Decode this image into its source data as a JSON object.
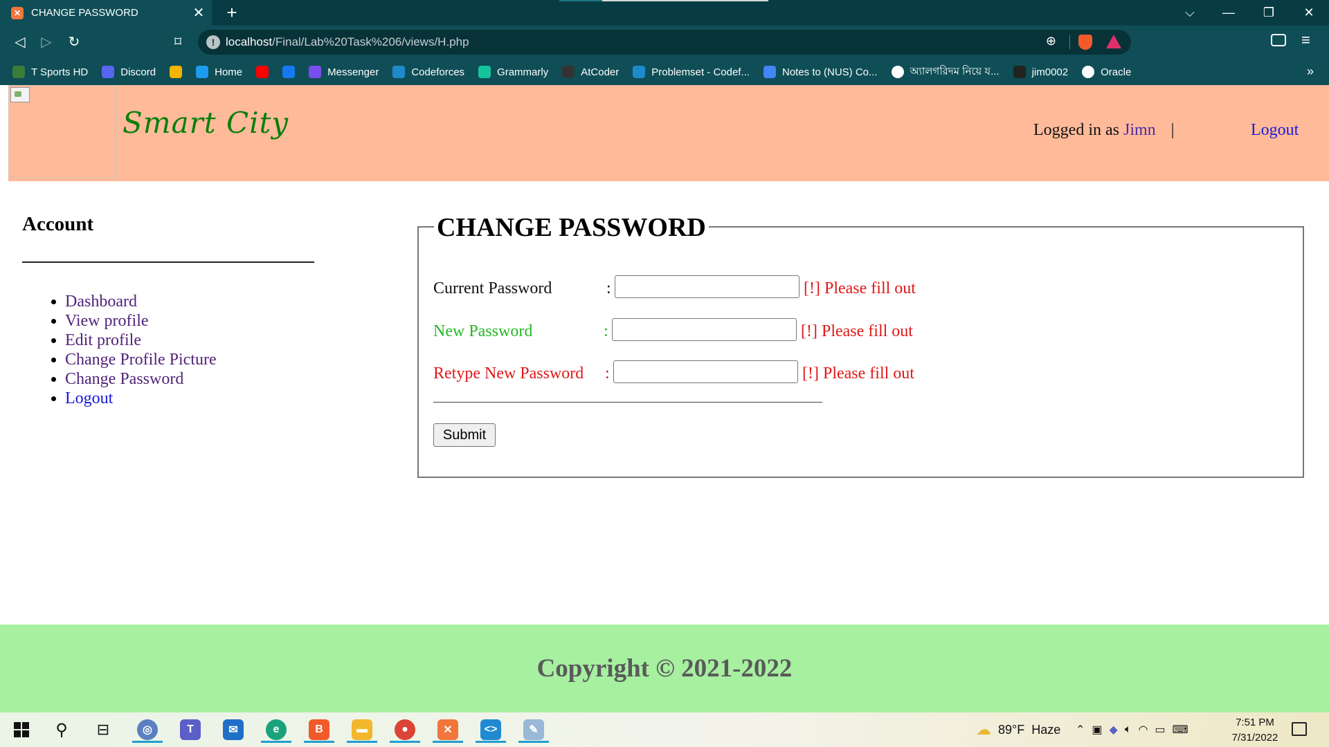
{
  "browser": {
    "tab_title": "CHANGE PASSWORD",
    "tab_close": "✕",
    "new_tab": "+",
    "url_host": "localhost",
    "url_path": "/Final/Lab%20Task%206/views/H.php",
    "bookmarks": [
      {
        "label": "T Sports HD",
        "icon": "tsports-icon",
        "color": "#3a7d3a"
      },
      {
        "label": "Discord",
        "icon": "discord-icon",
        "color": "#5865f2"
      },
      {
        "label": "",
        "icon": "google-drive-icon",
        "color": "#f4b400"
      },
      {
        "label": "Home",
        "icon": "twitter-icon",
        "color": "#1d9bf0"
      },
      {
        "label": "",
        "icon": "youtube-icon",
        "color": "#ff0000"
      },
      {
        "label": "",
        "icon": "facebook-icon",
        "color": "#1877f2"
      },
      {
        "label": "Messenger",
        "icon": "messenger-icon",
        "color": "#7a4df0"
      },
      {
        "label": "Codeforces",
        "icon": "codeforces-icon",
        "color": "#1f8acb"
      },
      {
        "label": "Grammarly",
        "icon": "grammarly-icon",
        "color": "#15c39a"
      },
      {
        "label": "AtCoder",
        "icon": "atcoder-icon",
        "color": "#333333"
      },
      {
        "label": "Problemset - Codef...",
        "icon": "codeforces-icon",
        "color": "#1f8acb"
      },
      {
        "label": "Notes to (NUS) Co...",
        "icon": "docs-icon",
        "color": "#4285f4"
      },
      {
        "label": "অ্যালগরিদম নিয়ে য...",
        "icon": "globe-icon",
        "color": "#ffffff"
      },
      {
        "label": "jim0002",
        "icon": "github-icon",
        "color": "#222222"
      },
      {
        "label": "Oracle",
        "icon": "globe-icon",
        "color": "#ffffff"
      }
    ],
    "bookmarks_more": "»"
  },
  "header": {
    "site_title": "Smart City",
    "logged_in_prefix": "Logged in as",
    "username": "Jimn",
    "separator": "|",
    "logout_label": "Logout"
  },
  "sidebar": {
    "title": "Account",
    "items": [
      {
        "label": "Dashboard"
      },
      {
        "label": "View profile"
      },
      {
        "label": "Edit profile"
      },
      {
        "label": "Change Profile Picture"
      },
      {
        "label": "Change Password"
      },
      {
        "label": "Logout"
      }
    ]
  },
  "form": {
    "legend": "CHANGE PASSWORD",
    "fields": [
      {
        "label": "Current Password",
        "colon": ":",
        "value": "",
        "error": "[!] Please fill out",
        "label_color": "#111111"
      },
      {
        "label": "New Password",
        "colon": ":",
        "value": "",
        "error": "[!] Please fill out",
        "label_color": "#22b822"
      },
      {
        "label": "Retype New Password",
        "colon": ":",
        "value": "",
        "error": "[!] Please fill out",
        "label_color": "#e01818"
      }
    ],
    "submit_label": "Submit"
  },
  "footer": {
    "copyright": "Copyright © 2021-2022"
  },
  "taskbar": {
    "weather_temp": "89°F",
    "weather_desc": "Haze",
    "time": "7:51 PM",
    "date": "7/31/2022"
  },
  "colors": {
    "header_bg": "#ffba9a",
    "footer_bg": "#a6f0a0",
    "error_red": "#e01818",
    "title_green": "#0a7f0a",
    "visited_link": "#51237a",
    "link_blue": "#1717d6"
  }
}
